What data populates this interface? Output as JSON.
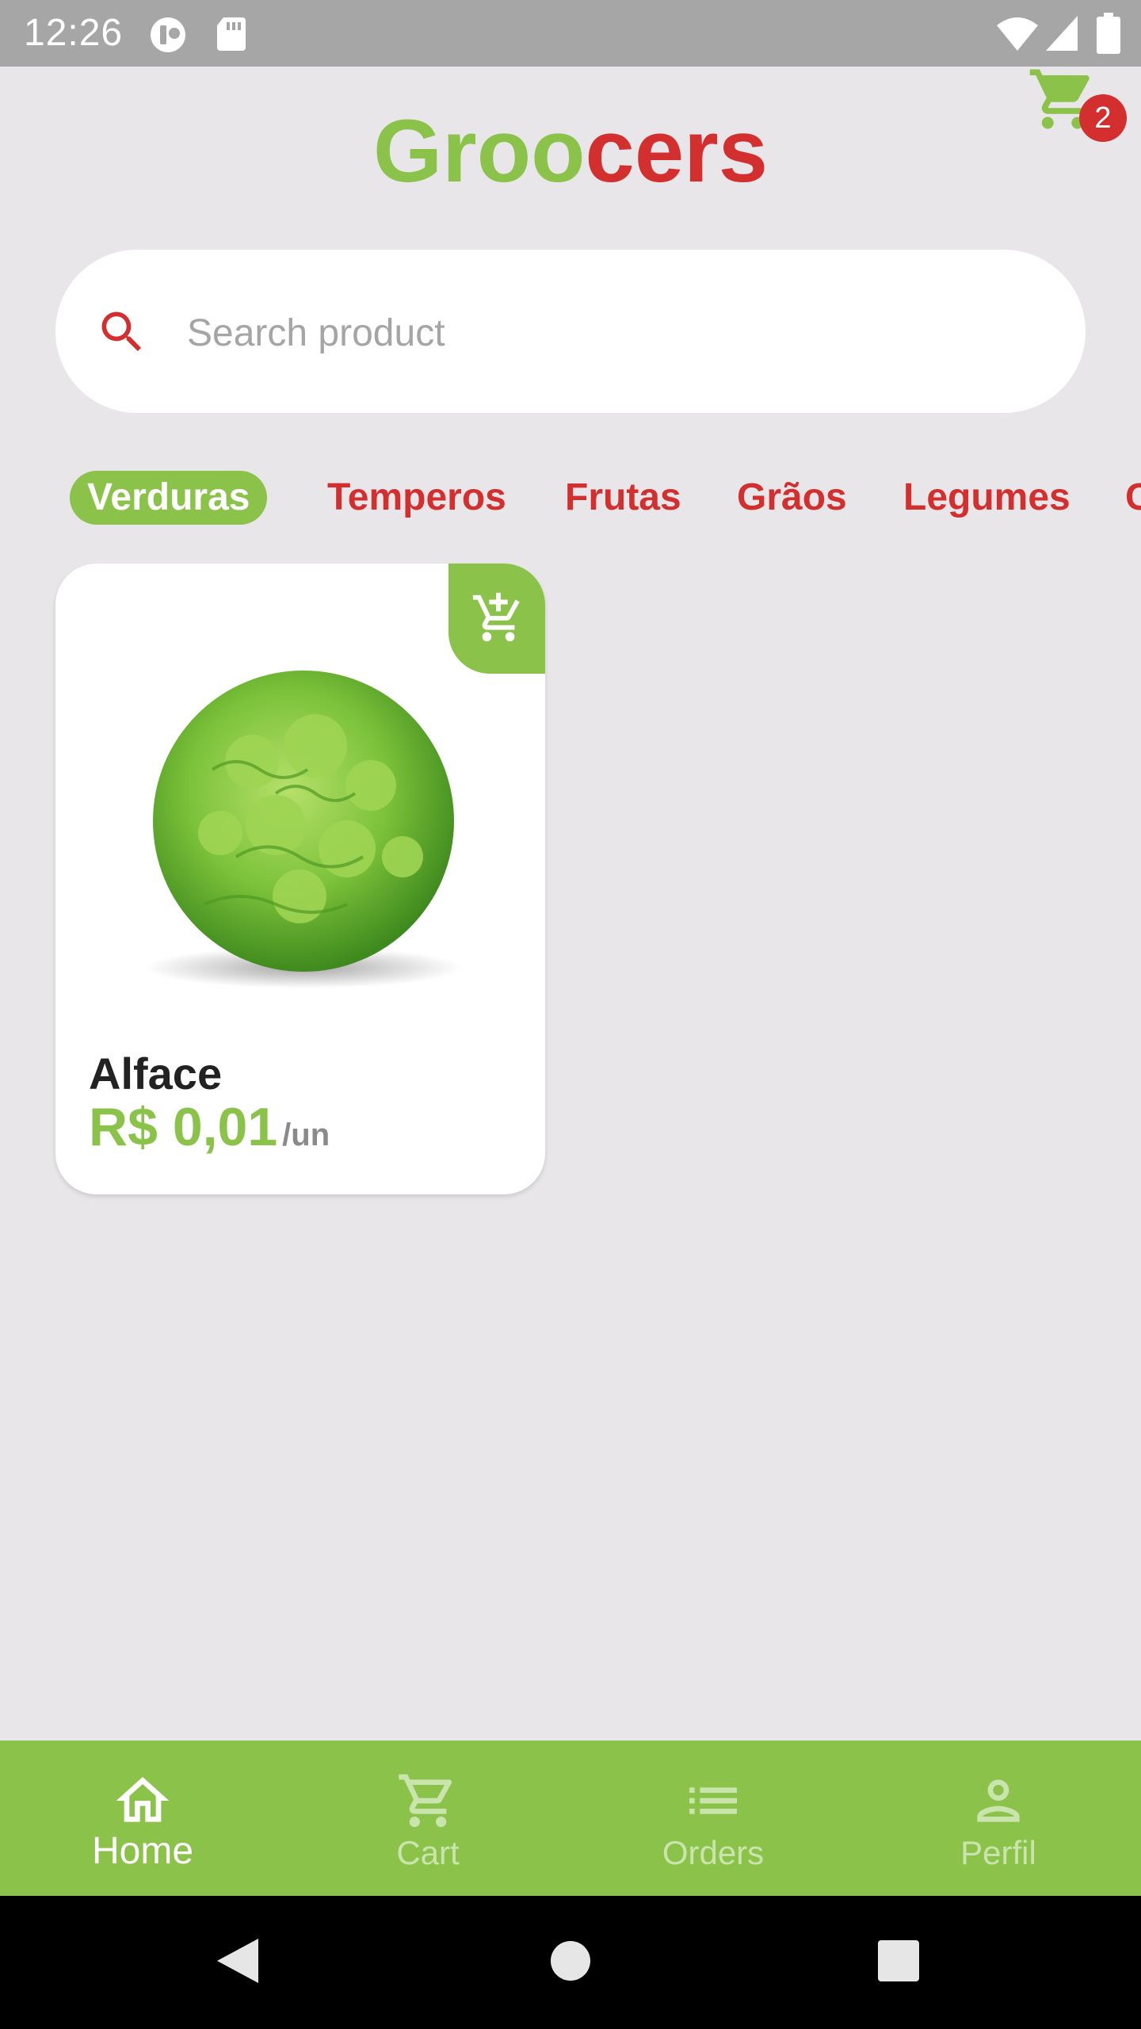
{
  "colors": {
    "accent_green": "#8bc34a",
    "accent_red": "#d32f2f"
  },
  "status_bar": {
    "time": "12:26",
    "icons": [
      "app-notification-icon",
      "sd-card-icon",
      "wifi-icon",
      "cellular-signal-icon",
      "battery-icon"
    ]
  },
  "header": {
    "brand_part1": "Groo",
    "brand_part2": "cers",
    "cart_icon": "cart-icon",
    "cart_count": "2"
  },
  "search": {
    "icon": "search-icon",
    "placeholder": "Search product",
    "value": ""
  },
  "categories": [
    {
      "label": "Verduras",
      "active": true
    },
    {
      "label": "Temperos",
      "active": false
    },
    {
      "label": "Frutas",
      "active": false
    },
    {
      "label": "Grãos",
      "active": false
    },
    {
      "label": "Legumes",
      "active": false
    },
    {
      "label": "C",
      "active": false
    }
  ],
  "products": [
    {
      "name": "Alface",
      "price": "R$ 0,01",
      "unit": "/un",
      "image": "lettuce-image",
      "action_icon": "add-shopping-cart-icon"
    }
  ],
  "bottom_nav": [
    {
      "label": "Home",
      "icon": "home-icon",
      "active": true
    },
    {
      "label": "Cart",
      "icon": "cart-icon",
      "active": false
    },
    {
      "label": "Orders",
      "icon": "list-icon",
      "active": false
    },
    {
      "label": "Perfil",
      "icon": "person-icon",
      "active": false
    }
  ],
  "system_nav": [
    "back-icon",
    "home-circle-icon",
    "recents-icon"
  ]
}
